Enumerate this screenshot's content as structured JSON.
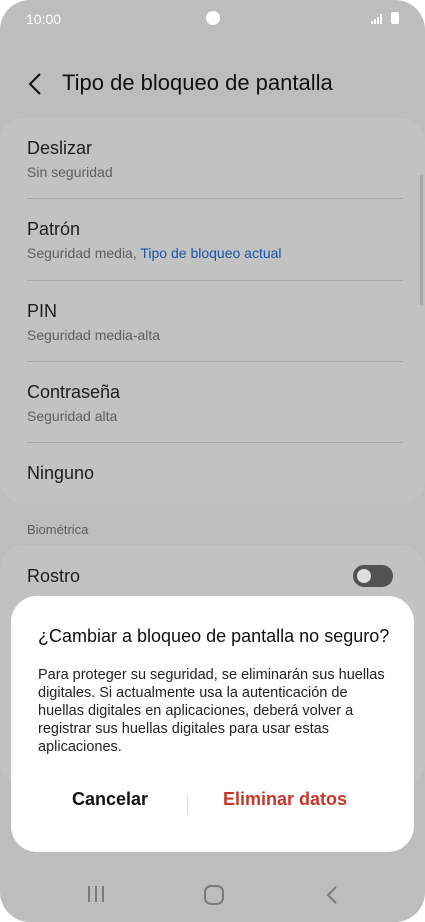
{
  "status_bar": {
    "time": "10:00"
  },
  "header": {
    "title": "Tipo de bloqueo de pantalla"
  },
  "lock_options": [
    {
      "label": "Deslizar",
      "subtitle": "Sin seguridad",
      "subtitle_highlight": ""
    },
    {
      "label": "Patrón",
      "subtitle": "Seguridad media, ",
      "subtitle_highlight": "Tipo de bloqueo actual"
    },
    {
      "label": "PIN",
      "subtitle": "Seguridad media-alta",
      "subtitle_highlight": ""
    },
    {
      "label": "Contraseña",
      "subtitle": "Seguridad alta",
      "subtitle_highlight": ""
    },
    {
      "label": "Ninguno",
      "subtitle": "",
      "subtitle_highlight": ""
    }
  ],
  "biometrics": {
    "section_title": "Biométrica",
    "face_label": "Rostro",
    "face_toggle_on": false
  },
  "dialog": {
    "title": "¿Cambiar a bloqueo de pantalla no seguro?",
    "body": "Para proteger su seguridad, se eliminarán sus huellas digitales. Si actualmente usa la autenticación de huellas digitales en aplicaciones, deberá volver a registrar sus huellas digitales para usar estas aplicaciones.",
    "cancel_label": "Cancelar",
    "confirm_label": "Eliminar datos"
  },
  "colors": {
    "link": "#1a56a8",
    "destructive": "#c8362a",
    "overlay": "#bdbdbd"
  },
  "icons": [
    "back-arrow-icon",
    "recents-icon",
    "home-icon",
    "nav-back-icon"
  ]
}
